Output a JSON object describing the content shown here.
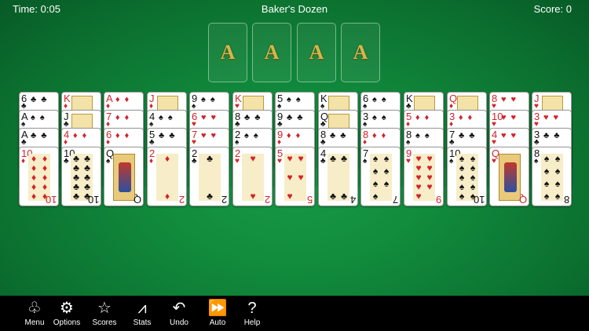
{
  "header": {
    "time": "Time: 0:05",
    "title": "Baker's Dozen",
    "score": "Score: 0"
  },
  "foundations": [
    "A",
    "A",
    "A",
    "A"
  ],
  "tableau": [
    {
      "cards": [
        {
          "r": "6",
          "s": "♣",
          "c": "black"
        },
        {
          "r": "A",
          "s": "♠",
          "c": "black"
        },
        {
          "r": "A",
          "s": "♣",
          "c": "black"
        },
        {
          "r": "10",
          "s": "♦",
          "c": "red",
          "top": true
        }
      ]
    },
    {
      "cards": [
        {
          "r": "K",
          "s": "♦",
          "c": "red",
          "face": true
        },
        {
          "r": "J",
          "s": "♣",
          "c": "black",
          "face": true
        },
        {
          "r": "4",
          "s": "♦",
          "c": "red"
        },
        {
          "r": "10",
          "s": "♣",
          "c": "black",
          "top": true
        }
      ]
    },
    {
      "cards": [
        {
          "r": "A",
          "s": "♦",
          "c": "red"
        },
        {
          "r": "7",
          "s": "♦",
          "c": "red"
        },
        {
          "r": "6",
          "s": "♦",
          "c": "red"
        },
        {
          "r": "Q",
          "s": "♠",
          "c": "black",
          "top": true,
          "face": true
        }
      ]
    },
    {
      "cards": [
        {
          "r": "J",
          "s": "♦",
          "c": "red",
          "face": true
        },
        {
          "r": "4",
          "s": "♠",
          "c": "black"
        },
        {
          "r": "5",
          "s": "♣",
          "c": "black"
        },
        {
          "r": "2",
          "s": "♦",
          "c": "red",
          "top": true
        }
      ]
    },
    {
      "cards": [
        {
          "r": "9",
          "s": "♠",
          "c": "black"
        },
        {
          "r": "6",
          "s": "♥",
          "c": "red"
        },
        {
          "r": "7",
          "s": "♥",
          "c": "red"
        },
        {
          "r": "2",
          "s": "♣",
          "c": "black",
          "top": true
        }
      ]
    },
    {
      "cards": [
        {
          "r": "K",
          "s": "♥",
          "c": "red",
          "face": true
        },
        {
          "r": "8",
          "s": "♣",
          "c": "black"
        },
        {
          "r": "2",
          "s": "♠",
          "c": "black"
        },
        {
          "r": "2",
          "s": "♥",
          "c": "red",
          "top": true
        }
      ]
    },
    {
      "cards": [
        {
          "r": "5",
          "s": "♠",
          "c": "black"
        },
        {
          "r": "9",
          "s": "♣",
          "c": "black"
        },
        {
          "r": "9",
          "s": "♦",
          "c": "red"
        },
        {
          "r": "5",
          "s": "♥",
          "c": "red",
          "top": true
        }
      ]
    },
    {
      "cards": [
        {
          "r": "K",
          "s": "♠",
          "c": "black",
          "face": true
        },
        {
          "r": "Q",
          "s": "♣",
          "c": "black",
          "face": true
        },
        {
          "r": "8",
          "s": "♣",
          "c": "black"
        },
        {
          "r": "4",
          "s": "♣",
          "c": "black",
          "top": true
        }
      ]
    },
    {
      "cards": [
        {
          "r": "6",
          "s": "♠",
          "c": "black"
        },
        {
          "r": "3",
          "s": "♠",
          "c": "black"
        },
        {
          "r": "8",
          "s": "♦",
          "c": "red"
        },
        {
          "r": "7",
          "s": "♠",
          "c": "black",
          "top": true
        }
      ]
    },
    {
      "cards": [
        {
          "r": "K",
          "s": "♣",
          "c": "black",
          "face": true
        },
        {
          "r": "5",
          "s": "♦",
          "c": "red"
        },
        {
          "r": "8",
          "s": "♠",
          "c": "black"
        },
        {
          "r": "9",
          "s": "♥",
          "c": "red",
          "top": true
        }
      ]
    },
    {
      "cards": [
        {
          "r": "Q",
          "s": "♦",
          "c": "red",
          "face": true
        },
        {
          "r": "3",
          "s": "♦",
          "c": "red"
        },
        {
          "r": "7",
          "s": "♣",
          "c": "black"
        },
        {
          "r": "10",
          "s": "♠",
          "c": "black",
          "top": true
        }
      ]
    },
    {
      "cards": [
        {
          "r": "8",
          "s": "♥",
          "c": "red"
        },
        {
          "r": "10",
          "s": "♥",
          "c": "red"
        },
        {
          "r": "4",
          "s": "♥",
          "c": "red"
        },
        {
          "r": "Q",
          "s": "♥",
          "c": "red",
          "top": true,
          "face": true
        }
      ]
    },
    {
      "cards": [
        {
          "r": "J",
          "s": "♥",
          "c": "red",
          "face": true
        },
        {
          "r": "3",
          "s": "♥",
          "c": "red"
        },
        {
          "r": "3",
          "s": "♣",
          "c": "black"
        },
        {
          "r": "8",
          "s": "♠",
          "c": "black",
          "top": true
        }
      ]
    }
  ],
  "toolbar": [
    {
      "label": "Menu",
      "icon": "menu-icon",
      "glyph": "♧"
    },
    {
      "label": "Options",
      "icon": "gear-icon",
      "glyph": "⚙"
    },
    {
      "label": "Scores",
      "icon": "star-icon",
      "glyph": "☆"
    },
    {
      "label": "Stats",
      "icon": "chart-icon",
      "glyph": "⩘"
    },
    {
      "label": "Undo",
      "icon": "undo-icon",
      "glyph": "↶"
    },
    {
      "label": "Auto",
      "icon": "fast-forward-icon",
      "glyph": "⏩"
    },
    {
      "label": "Help",
      "icon": "help-icon",
      "glyph": "?"
    }
  ]
}
